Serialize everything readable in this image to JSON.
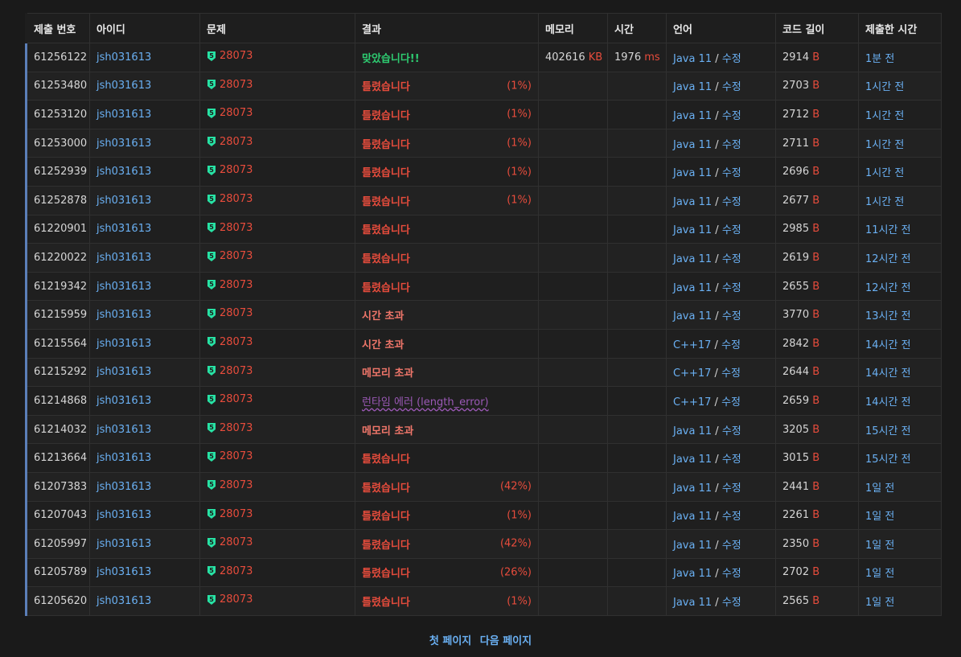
{
  "headers": {
    "submission_id": "제출 번호",
    "user_id": "아이디",
    "problem": "문제",
    "result": "결과",
    "memory": "메모리",
    "time": "시간",
    "language": "언어",
    "code_length": "코드 길이",
    "submitted_at": "제출한 시간"
  },
  "units": {
    "memory": "KB",
    "time": "ms",
    "code_length": "B"
  },
  "edit_label": "수정",
  "tier_icon_label": "5",
  "colors": {
    "accepted": "#2ecc71",
    "wrong": "#e74c3c",
    "runtime_error": "#9b59b6",
    "link": "#6ab0f3",
    "tier_badge": "#27e2a4"
  },
  "rows": [
    {
      "id": "61256122",
      "user": "jsh031613",
      "problem": "28073",
      "result": "맞았습니다!!",
      "result_type": "ac",
      "pct": "",
      "memory": "402616",
      "time": "1976",
      "lang": "Java 11",
      "length": "2914",
      "when": "1분 전"
    },
    {
      "id": "61253480",
      "user": "jsh031613",
      "problem": "28073",
      "result": "틀렸습니다",
      "result_type": "wa",
      "pct": "(1%)",
      "memory": "",
      "time": "",
      "lang": "Java 11",
      "length": "2703",
      "when": "1시간 전"
    },
    {
      "id": "61253120",
      "user": "jsh031613",
      "problem": "28073",
      "result": "틀렸습니다",
      "result_type": "wa",
      "pct": "(1%)",
      "memory": "",
      "time": "",
      "lang": "Java 11",
      "length": "2712",
      "when": "1시간 전"
    },
    {
      "id": "61253000",
      "user": "jsh031613",
      "problem": "28073",
      "result": "틀렸습니다",
      "result_type": "wa",
      "pct": "(1%)",
      "memory": "",
      "time": "",
      "lang": "Java 11",
      "length": "2711",
      "when": "1시간 전"
    },
    {
      "id": "61252939",
      "user": "jsh031613",
      "problem": "28073",
      "result": "틀렸습니다",
      "result_type": "wa",
      "pct": "(1%)",
      "memory": "",
      "time": "",
      "lang": "Java 11",
      "length": "2696",
      "when": "1시간 전"
    },
    {
      "id": "61252878",
      "user": "jsh031613",
      "problem": "28073",
      "result": "틀렸습니다",
      "result_type": "wa",
      "pct": "(1%)",
      "memory": "",
      "time": "",
      "lang": "Java 11",
      "length": "2677",
      "when": "1시간 전"
    },
    {
      "id": "61220901",
      "user": "jsh031613",
      "problem": "28073",
      "result": "틀렸습니다",
      "result_type": "wa",
      "pct": "",
      "memory": "",
      "time": "",
      "lang": "Java 11",
      "length": "2985",
      "when": "11시간 전"
    },
    {
      "id": "61220022",
      "user": "jsh031613",
      "problem": "28073",
      "result": "틀렸습니다",
      "result_type": "wa",
      "pct": "",
      "memory": "",
      "time": "",
      "lang": "Java 11",
      "length": "2619",
      "when": "12시간 전"
    },
    {
      "id": "61219342",
      "user": "jsh031613",
      "problem": "28073",
      "result": "틀렸습니다",
      "result_type": "wa",
      "pct": "",
      "memory": "",
      "time": "",
      "lang": "Java 11",
      "length": "2655",
      "when": "12시간 전"
    },
    {
      "id": "61215959",
      "user": "jsh031613",
      "problem": "28073",
      "result": "시간 초과",
      "result_type": "tle",
      "pct": "",
      "memory": "",
      "time": "",
      "lang": "Java 11",
      "length": "3770",
      "when": "13시간 전"
    },
    {
      "id": "61215564",
      "user": "jsh031613",
      "problem": "28073",
      "result": "시간 초과",
      "result_type": "tle",
      "pct": "",
      "memory": "",
      "time": "",
      "lang": "C++17",
      "length": "2842",
      "when": "14시간 전"
    },
    {
      "id": "61215292",
      "user": "jsh031613",
      "problem": "28073",
      "result": "메모리 초과",
      "result_type": "tle",
      "pct": "",
      "memory": "",
      "time": "",
      "lang": "C++17",
      "length": "2644",
      "when": "14시간 전"
    },
    {
      "id": "61214868",
      "user": "jsh031613",
      "problem": "28073",
      "result": "런타임 에러 (length_error)",
      "result_type": "re",
      "pct": "",
      "memory": "",
      "time": "",
      "lang": "C++17",
      "length": "2659",
      "when": "14시간 전"
    },
    {
      "id": "61214032",
      "user": "jsh031613",
      "problem": "28073",
      "result": "메모리 초과",
      "result_type": "tle",
      "pct": "",
      "memory": "",
      "time": "",
      "lang": "Java 11",
      "length": "3205",
      "when": "15시간 전"
    },
    {
      "id": "61213664",
      "user": "jsh031613",
      "problem": "28073",
      "result": "틀렸습니다",
      "result_type": "wa",
      "pct": "",
      "memory": "",
      "time": "",
      "lang": "Java 11",
      "length": "3015",
      "when": "15시간 전"
    },
    {
      "id": "61207383",
      "user": "jsh031613",
      "problem": "28073",
      "result": "틀렸습니다",
      "result_type": "wa",
      "pct": "(42%)",
      "memory": "",
      "time": "",
      "lang": "Java 11",
      "length": "2441",
      "when": "1일 전"
    },
    {
      "id": "61207043",
      "user": "jsh031613",
      "problem": "28073",
      "result": "틀렸습니다",
      "result_type": "wa",
      "pct": "(1%)",
      "memory": "",
      "time": "",
      "lang": "Java 11",
      "length": "2261",
      "when": "1일 전"
    },
    {
      "id": "61205997",
      "user": "jsh031613",
      "problem": "28073",
      "result": "틀렸습니다",
      "result_type": "wa",
      "pct": "(42%)",
      "memory": "",
      "time": "",
      "lang": "Java 11",
      "length": "2350",
      "when": "1일 전"
    },
    {
      "id": "61205789",
      "user": "jsh031613",
      "problem": "28073",
      "result": "틀렸습니다",
      "result_type": "wa",
      "pct": "(26%)",
      "memory": "",
      "time": "",
      "lang": "Java 11",
      "length": "2702",
      "when": "1일 전"
    },
    {
      "id": "61205620",
      "user": "jsh031613",
      "problem": "28073",
      "result": "틀렸습니다",
      "result_type": "wa",
      "pct": "(1%)",
      "memory": "",
      "time": "",
      "lang": "Java 11",
      "length": "2565",
      "when": "1일 전"
    }
  ],
  "pagination": {
    "first_page": "첫 페이지",
    "next_page": "다음 페이지"
  }
}
